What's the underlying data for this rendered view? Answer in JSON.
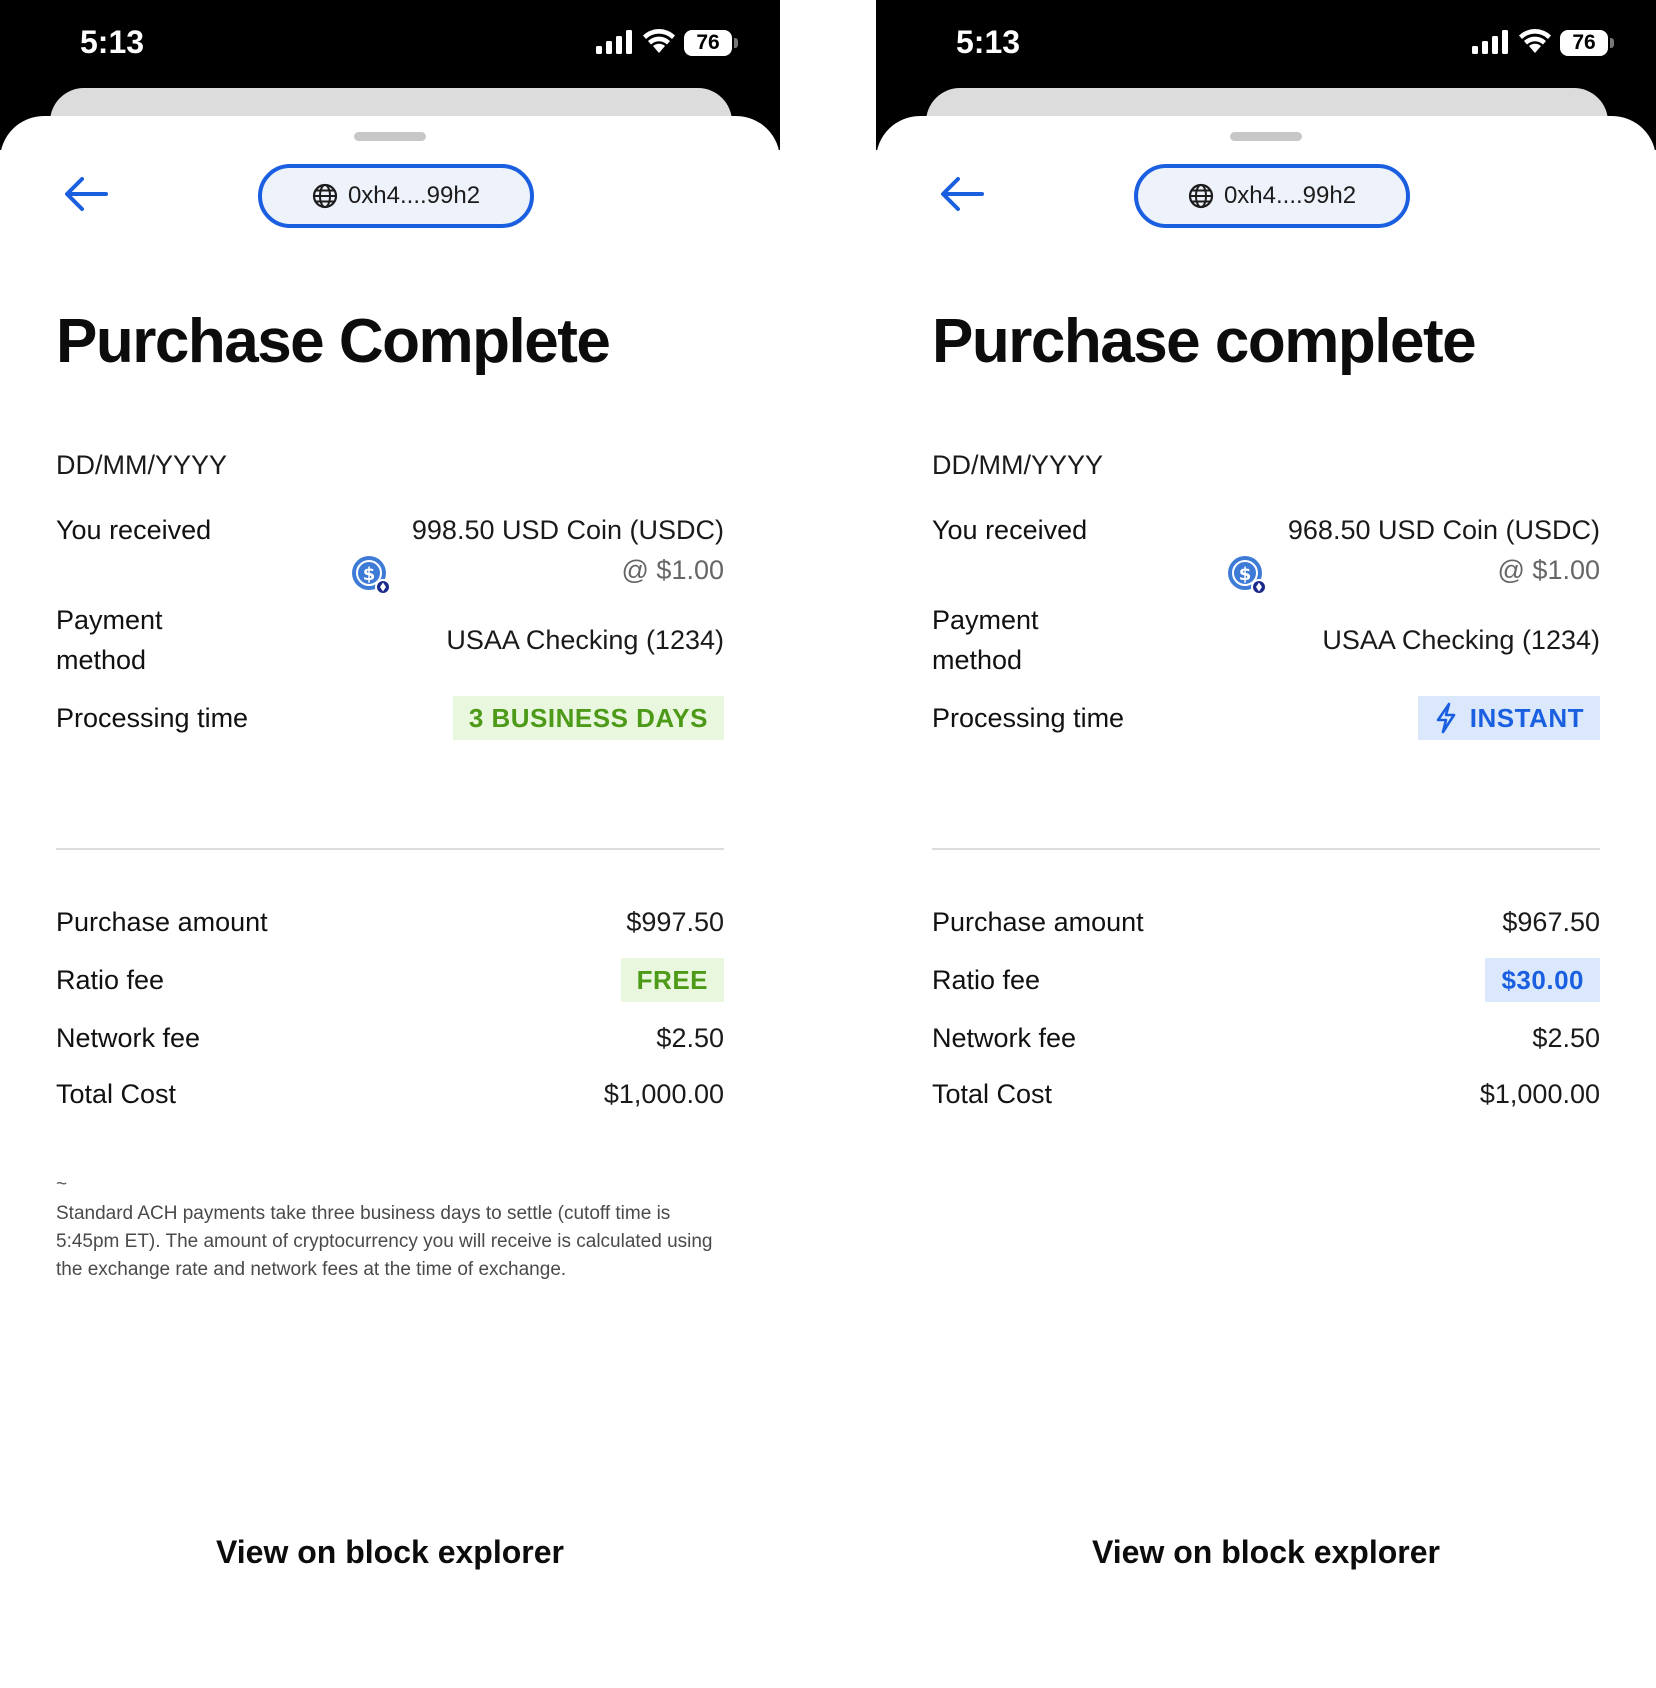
{
  "screens": [
    {
      "status_bar": {
        "time": "5:13",
        "battery": "76"
      },
      "header": {
        "address": "0xh4....99h2",
        "icons": {
          "back": "arrow-left-icon",
          "address": "globe-icon"
        }
      },
      "title": "Purchase Complete",
      "date": "DD/MM/YYYY",
      "details": {
        "received_label": "You received",
        "received_amount": "998.50 USD Coin (USDC)",
        "received_rate": "@ $1.00",
        "received_icon": "usdc-coin-icon",
        "payment_label_line1": "Payment",
        "payment_label_line2": "method",
        "payment_value": "USAA Checking (1234)",
        "processing_label": "Processing time",
        "processing_value": "3 BUSINESS DAYS"
      },
      "costs": {
        "purchase_label": "Purchase amount",
        "purchase_value": "$997.50",
        "ratio_label": "Ratio fee",
        "ratio_value": "FREE",
        "network_label": "Network fee",
        "network_value": "$2.50",
        "total_label": "Total Cost",
        "total_value": "$1,000.00"
      },
      "footnote_marker": "~",
      "footnote": "Standard ACH payments take three business days to settle (cutoff time is 5:45pm ET). The amount of cryptocurrency you will receive is calculated using the exchange rate and network fees at the time of exchange.",
      "block_explorer_label": "View on block explorer"
    },
    {
      "status_bar": {
        "time": "5:13",
        "battery": "76"
      },
      "header": {
        "address": "0xh4....99h2",
        "icons": {
          "back": "arrow-left-icon",
          "address": "globe-icon"
        }
      },
      "title": "Purchase complete",
      "date": "DD/MM/YYYY",
      "details": {
        "received_label": "You received",
        "received_amount": "968.50 USD Coin (USDC)",
        "received_rate": "@ $1.00",
        "received_icon": "usdc-coin-icon",
        "payment_label_line1": "Payment",
        "payment_label_line2": "method",
        "payment_value": "USAA Checking (1234)",
        "processing_label": "Processing time",
        "processing_value": "INSTANT",
        "processing_icon": "lightning-icon"
      },
      "costs": {
        "purchase_label": "Purchase amount",
        "purchase_value": "$967.50",
        "ratio_label": "Ratio fee",
        "ratio_value": "$30.00",
        "network_label": "Network fee",
        "network_value": "$2.50",
        "total_label": "Total Cost",
        "total_value": "$1,000.00"
      },
      "block_explorer_label": "View on block explorer"
    }
  ],
  "colors": {
    "accent": "#1a5fe0",
    "badge_green_bg": "#eaf7df",
    "badge_green_text": "#4c9a18",
    "badge_blue_bg": "#dbe8fb",
    "status_bar": "#000000",
    "pill_bg": "#eef2fb"
  }
}
